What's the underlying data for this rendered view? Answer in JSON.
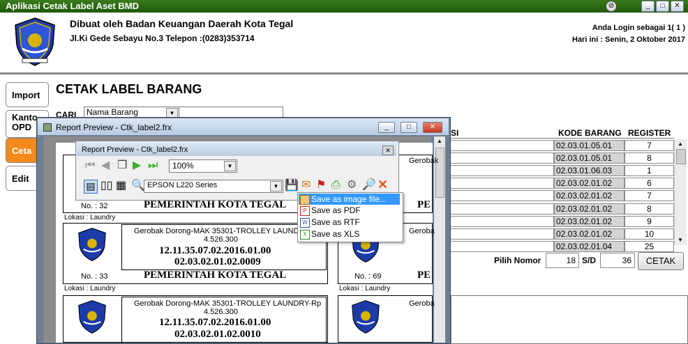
{
  "window": {
    "title": "Aplikasi Cetak Label Aset BMD"
  },
  "header": {
    "org_name": "Dibuat oleh Badan Keuangan Daerah Kota Tegal",
    "address": "Jl.Ki Gede Sebayu No.3 Telepon :(0283)353714",
    "login_info": "Anda Login sebagai 1( 1 )",
    "date_info": "Hari ini : Senin, 2 Oktober 2017"
  },
  "nav": [
    "Import",
    "Kanto\nOPD",
    "Ceta",
    "Edit"
  ],
  "page_title": "CETAK LABEL BARANG",
  "search": {
    "label": "CARI",
    "field": "Nama Barang"
  },
  "table": {
    "col_partial": "SI",
    "col_code": "KODE BARANG",
    "col_register": "REGISTER",
    "rows": [
      {
        "code": "02.03.01.05.01",
        "register": "7"
      },
      {
        "code": "02.03.01.05.01",
        "register": "8"
      },
      {
        "code": "02.03.01.06.03",
        "register": "1"
      },
      {
        "code": "02.03.02.01.02",
        "register": "6"
      },
      {
        "code": "02.03.02.01.02",
        "register": "7"
      },
      {
        "code": "02.03.02.01.02",
        "register": "8"
      },
      {
        "code": "02.03.02.01.02",
        "register": "9"
      },
      {
        "code": "02.03.02.01.02",
        "register": "10"
      },
      {
        "code": "02.03.02.01.04",
        "register": "25"
      }
    ]
  },
  "pilih": {
    "label": "Pilih Nomor",
    "from": "18",
    "sd_label": "S/D",
    "to": "36",
    "button": "CETAK"
  },
  "preview_outer": {
    "title": "Report Preview - Ctk_label2.frx"
  },
  "preview_inner": {
    "title": "Report Preview - Ctk_label2.frx",
    "zoom": "100%",
    "printer": "EPSON L220 Series"
  },
  "save_menu": [
    "Save as image file...",
    "Save as PDF",
    "Save as RTF",
    "Save as XLS"
  ],
  "labels": {
    "row1": {
      "no_left": "No. : 32",
      "org_left": "PEMERINTAH KOTA TEGAL",
      "org_right_partial": "PE",
      "right_name_partial": "Gerobak"
    },
    "lokasi": "Lokasi : Laundry",
    "row2": {
      "name": "Gerobak Dorong-MAK 35301-TROLLEY LAUNDRY-Rp",
      "price": "4.526.300",
      "code1": "12.11.35.07.02.2016.01.00",
      "code2": "02.03.02.01.02.0009",
      "no_left": "No. : 33",
      "org": "PEMERINTAH KOTA TEGAL",
      "no_right": "No. : 69",
      "org_right_partial": "PE",
      "right_name_partial": "Geroba"
    },
    "row3": {
      "name": "Gerobak Dorong-MAK 35301-TROLLEY LAUNDRY-Rp",
      "price": "4.526.300",
      "code1": "12.11.35.07.02.2016.01.00",
      "code2": "02.03.02.01.02.0010",
      "right_name_partial": "Geroba"
    }
  }
}
